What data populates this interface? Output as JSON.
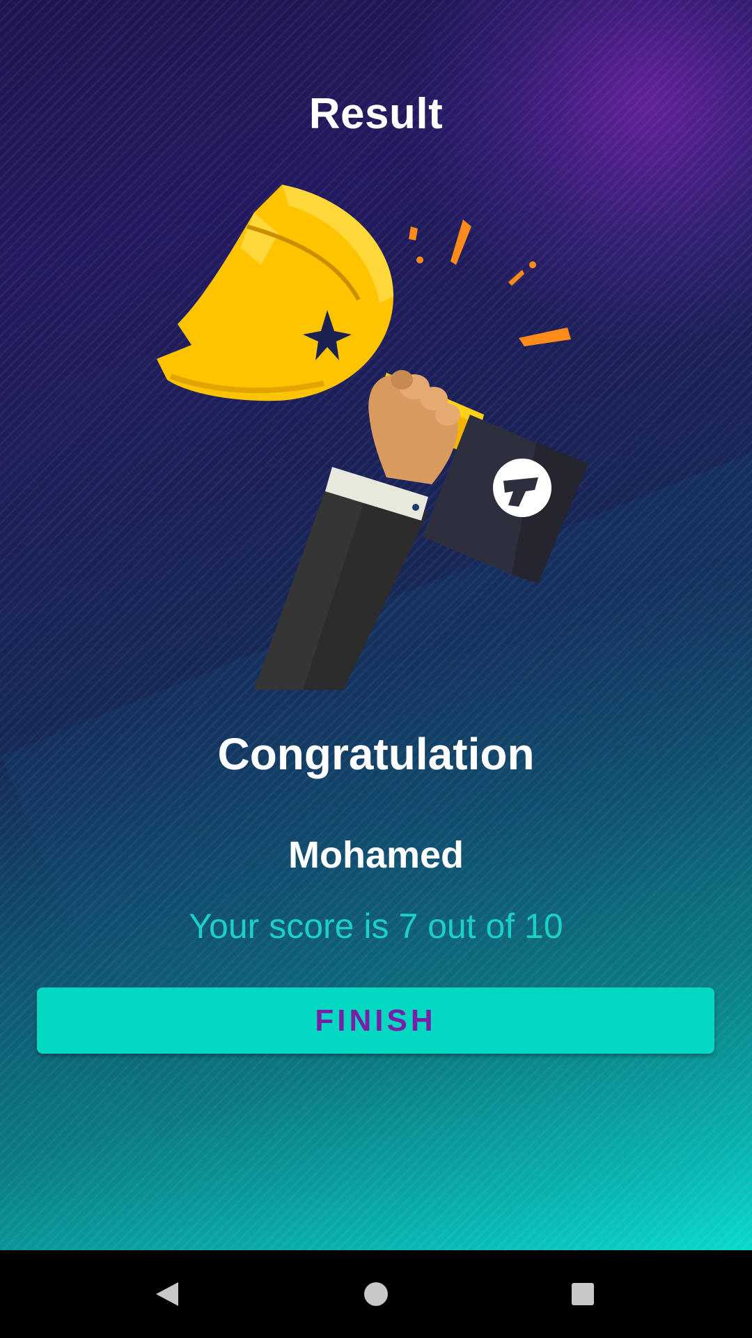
{
  "header": {
    "title": "Result"
  },
  "result": {
    "congrats_text": "Congratulation",
    "player_name": "Mohamed",
    "score_text": "Your score is 7 out of 10"
  },
  "actions": {
    "finish_label": "FINISH"
  },
  "colors": {
    "accent": "#03d8c2",
    "button_text": "#7a1ea6",
    "score_text": "#1ad1c3"
  },
  "icons": {
    "illustration": "trophy-hand-icon",
    "nav_back": "back-triangle-icon",
    "nav_home": "home-circle-icon",
    "nav_recents": "recents-square-icon"
  }
}
